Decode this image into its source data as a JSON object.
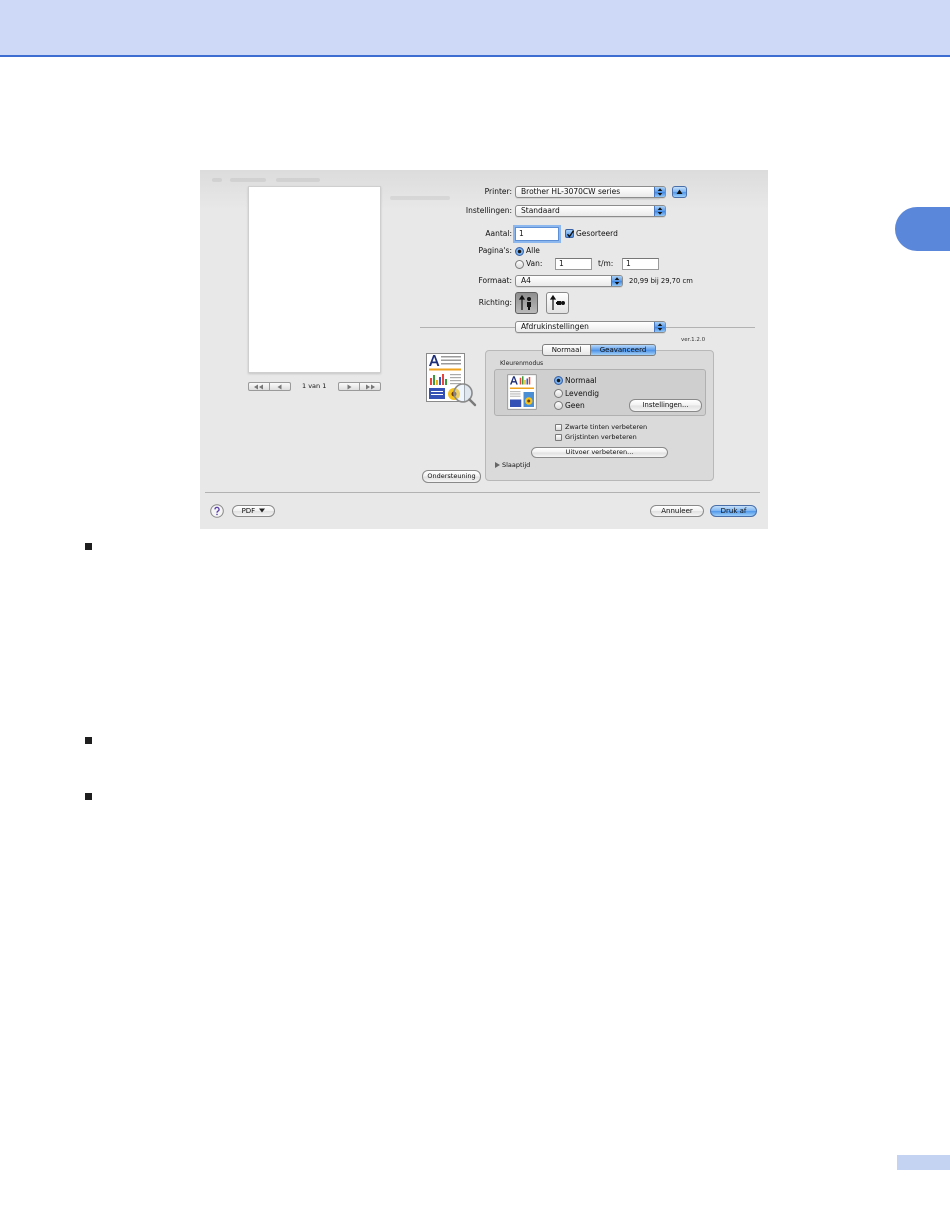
{
  "colors": {
    "header_band": "#cdd9f6",
    "header_rule": "#3d6dd0",
    "chapter_tab": "#5b87db",
    "page_number_box": "#c5d3f3",
    "default_button": "#4f96eb",
    "dialog_background": "#e8e8e8"
  },
  "icons": [
    "first-page-icon",
    "previous-page-icon",
    "next-page-icon",
    "last-page-icon",
    "printer-features-icon",
    "disclosure-up-icon",
    "popup-arrows-icon",
    "portrait-orientation-icon",
    "landscape-orientation-icon",
    "color-mode-icon",
    "disclosure-triangle-icon",
    "help-icon",
    "chevron-down-icon",
    "checkmark-icon"
  ],
  "dialog": {
    "preview": {
      "page_counter": "1 van 1"
    },
    "printer": {
      "label": "Printer:",
      "value": "Brother HL-3070CW series"
    },
    "presets": {
      "label": "Instellingen:",
      "value": "Standaard"
    },
    "copies": {
      "label": "Aantal:",
      "value": "1",
      "collated_label": "Gesorteerd",
      "collated": true
    },
    "pages": {
      "label": "Pagina's:",
      "options": [
        {
          "label": "Alle",
          "selected": true
        },
        {
          "label": "Van:",
          "selected": false
        }
      ],
      "from_value": "1",
      "to_label": "t/m:",
      "to_value": "1"
    },
    "paper_size": {
      "label": "Formaat:",
      "value": "A4",
      "dimensions": "20,99 bij 29,70 cm"
    },
    "orientation": {
      "label": "Richting:",
      "portrait_selected": true,
      "landscape_selected": false
    },
    "panel": {
      "value": "Afdrukinstellingen",
      "version": "ver.1.2.0"
    },
    "tabs": [
      {
        "label": "Normaal",
        "selected": false
      },
      {
        "label": "Geavanceerd",
        "selected": true
      }
    ],
    "color_mode": {
      "label": "Kleurenmodus",
      "options": [
        {
          "label": "Normaal",
          "selected": true
        },
        {
          "label": "Levendig",
          "selected": false
        },
        {
          "label": "Geen",
          "selected": false
        }
      ],
      "settings_button": "Instellingen..."
    },
    "enhance": [
      {
        "label": "Zwarte tinten verbeteren",
        "checked": false
      },
      {
        "label": "Grijstinten verbeteren",
        "checked": false
      }
    ],
    "output_button": "Uitvoer verbeteren...",
    "sleep_disclosure": "Slaaptijd",
    "support_button": "Ondersteuning",
    "pdf_button": "PDF",
    "cancel_button": "Annuleer",
    "print_button": "Druk af"
  }
}
